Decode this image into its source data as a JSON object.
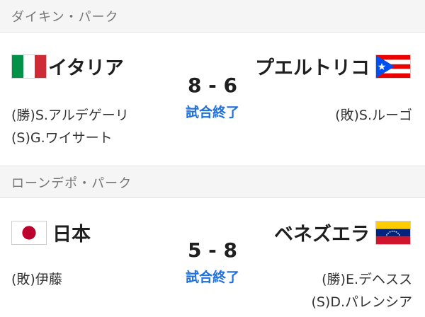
{
  "games": [
    {
      "venue": "ダイキン・パーク",
      "home": {
        "name": "イタリア",
        "flag": "italy-flag"
      },
      "away": {
        "name": "プエルトリコ",
        "flag": "puerto-rico-flag"
      },
      "score": "8 - 6",
      "status": "試合終了",
      "home_pitchers": [
        "(勝)S.アルデゲーリ",
        "(S)G.ワイサート"
      ],
      "away_pitchers": [
        "(敗)S.ルーゴ"
      ]
    },
    {
      "venue": "ローンデポ・パーク",
      "home": {
        "name": "日本",
        "flag": "japan-flag"
      },
      "away": {
        "name": "ベネズエラ",
        "flag": "venezuela-flag"
      },
      "score": "5 - 8",
      "status": "試合終了",
      "home_pitchers": [
        "(敗)伊藤"
      ],
      "away_pitchers": [
        "(勝)E.デヘスス",
        "(S)D.パレンシア"
      ]
    }
  ],
  "colors": {
    "status": "#1e6fe0",
    "venue_bar": "#f5f5f5",
    "venue_text": "#757575"
  }
}
